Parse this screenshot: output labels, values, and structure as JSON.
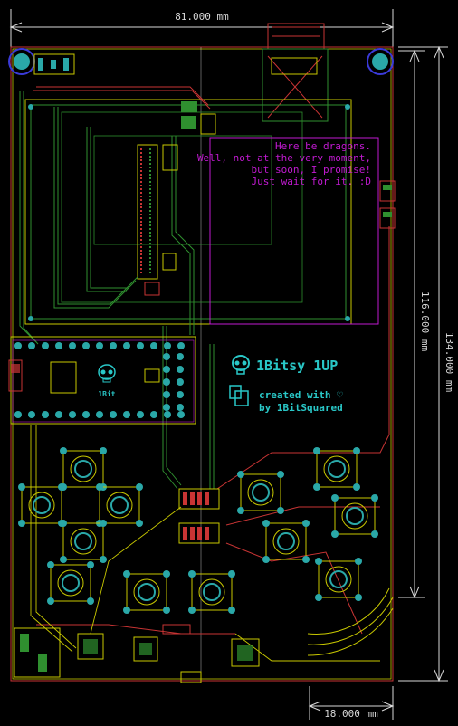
{
  "dimensions": {
    "top_width": "81.000 mm",
    "inner_height": "116.000 mm",
    "total_height": "134.000 mm",
    "bottom_width": "18.000 mm"
  },
  "board": {
    "title": "1Bitsy 1UP",
    "credit_line1": "created with ♡",
    "credit_line2": "by 1BitSquared",
    "dragon_note": [
      "Here be dragons.",
      "Well, not at the very moment,",
      "but soon, I promise!",
      "Just wait for it. :D"
    ],
    "small_label": "1Bit"
  },
  "colors": {
    "background": "#000000",
    "edge_cuts": "#c8c800",
    "front_copper": "#c83434",
    "back_copper": "#2f8f2f",
    "silkscreen": "#29c7c7",
    "fab": "#c11ad1",
    "pad": "#2aa8a8",
    "dimension": "#d8d8d8"
  }
}
